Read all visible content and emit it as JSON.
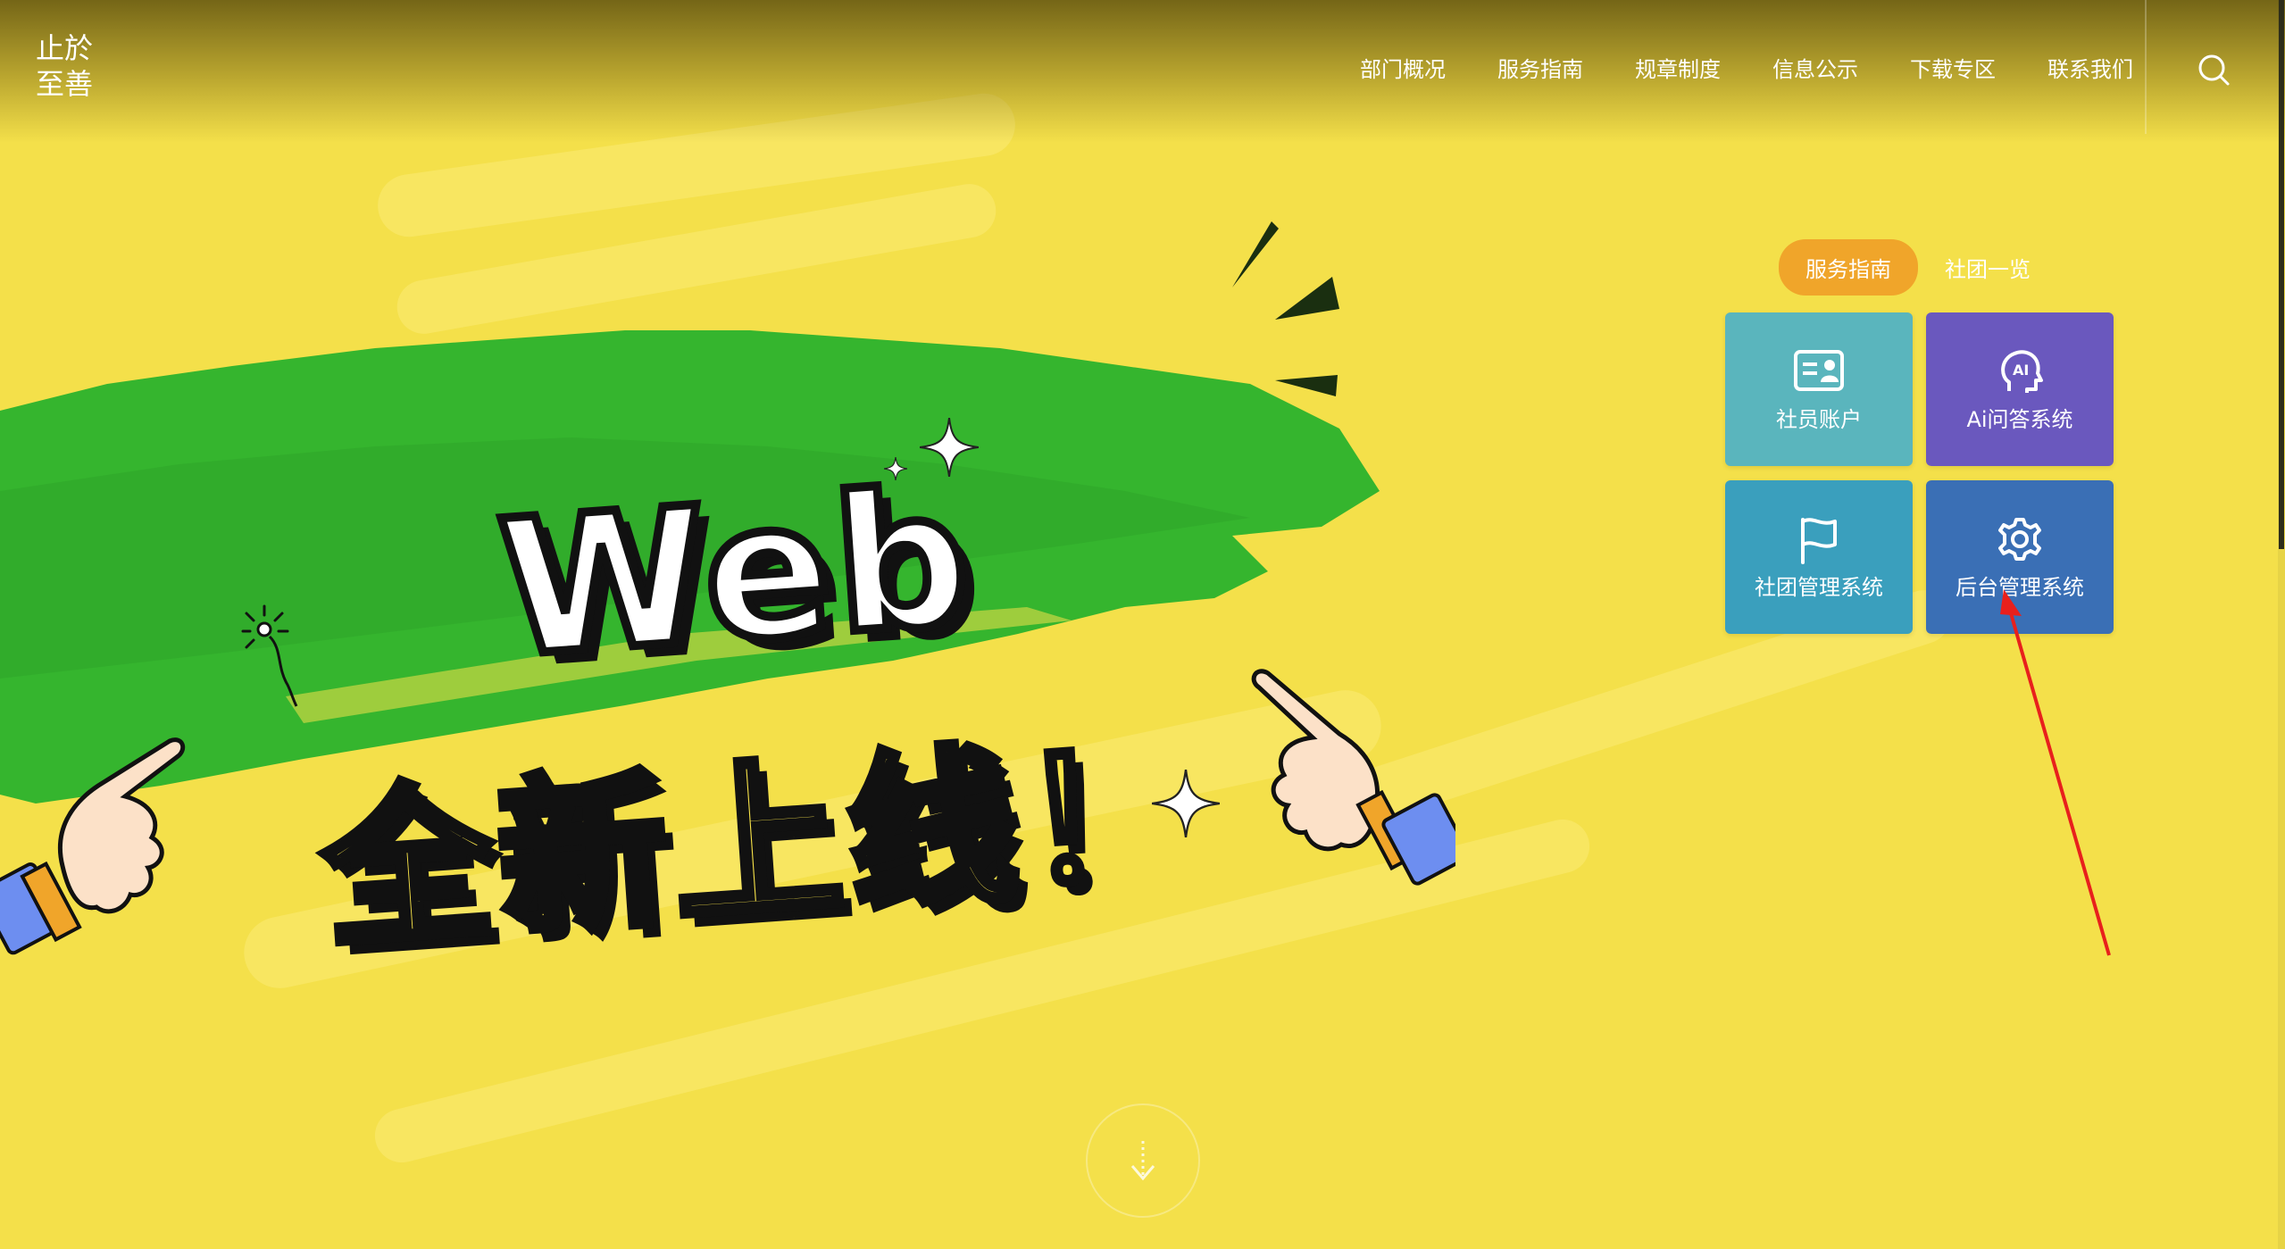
{
  "logo": {
    "line1": "止於",
    "line2": "至善"
  },
  "nav": {
    "items": [
      "部门概况",
      "服务指南",
      "规章制度",
      "信息公示",
      "下载专区",
      "联系我们"
    ]
  },
  "hero": {
    "headline": "Web",
    "subheadline": "全新上线！"
  },
  "quick_panel": {
    "tabs": [
      {
        "label": "服务指南"
      },
      {
        "label": "社团一览"
      }
    ],
    "tiles": [
      {
        "label": "社员账户",
        "icon": "member-card-icon",
        "color": "#5ab5bd"
      },
      {
        "label": "Ai问答系统",
        "icon": "ai-head-icon",
        "color": "#6a58be"
      },
      {
        "label": "社团管理系统",
        "icon": "flag-icon",
        "color": "#3a9fbd"
      },
      {
        "label": "后台管理系统",
        "icon": "gear-icon",
        "color": "#3a6fb5"
      }
    ]
  },
  "colors": {
    "background": "#f4e04a",
    "brush_green": "#35b52e",
    "tab_active": "#f0a52a",
    "annotation_arrow": "#e8201c"
  }
}
